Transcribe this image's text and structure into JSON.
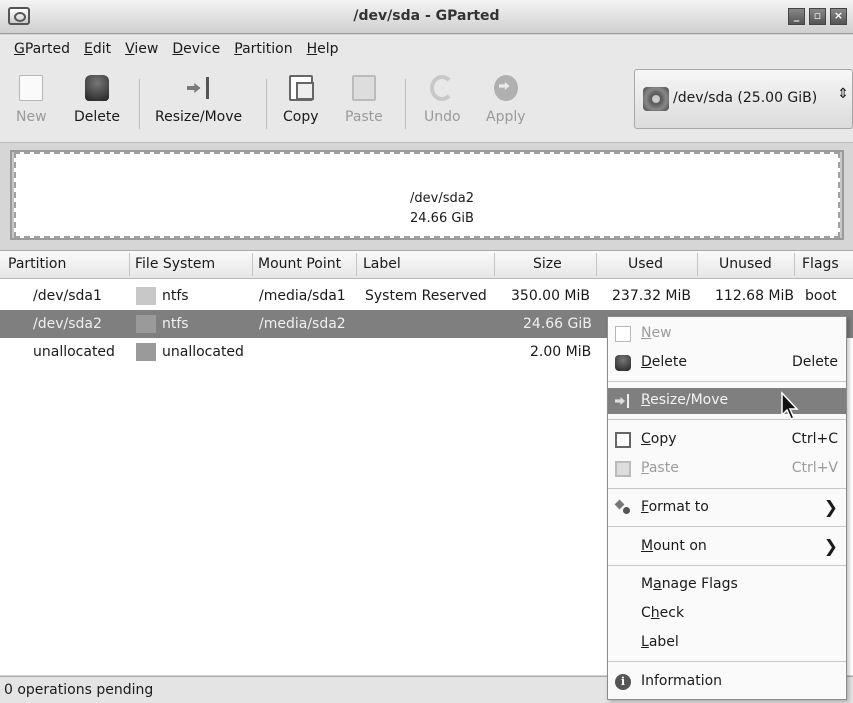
{
  "window": {
    "title": "/dev/sda - GParted",
    "controls": [
      "_",
      "▫",
      "×"
    ]
  },
  "menubar": {
    "items": [
      {
        "label": "GParted",
        "mnemonic": "G"
      },
      {
        "label": "Edit",
        "mnemonic": "E"
      },
      {
        "label": "View",
        "mnemonic": "V"
      },
      {
        "label": "Device",
        "mnemonic": "D"
      },
      {
        "label": "Partition",
        "mnemonic": "P"
      },
      {
        "label": "Help",
        "mnemonic": "H"
      }
    ]
  },
  "toolbar": {
    "new_label": "New",
    "delete_label": "Delete",
    "resize_label": "Resize/Move",
    "copy_label": "Copy",
    "paste_label": "Paste",
    "undo_label": "Undo",
    "apply_label": "Apply",
    "device": "/dev/sda  (25.00 GiB)",
    "device_spinner": "⇕"
  },
  "graphic": {
    "partition_name": "/dev/sda2",
    "partition_size": "24.66 GiB"
  },
  "table": {
    "headers": [
      "Partition",
      "File System",
      "Mount Point",
      "Label",
      "Size",
      "Used",
      "Unused",
      "Flags"
    ],
    "rows": [
      {
        "partition": "/dev/sda1",
        "fs": "ntfs",
        "fs_color": "#c8c8c8",
        "mount": "/media/sda1",
        "label": "System Reserved",
        "size": "350.00 MiB",
        "used": "237.32 MiB",
        "unused": "112.68 MiB",
        "flags": "boot",
        "selected": false
      },
      {
        "partition": "/dev/sda2",
        "fs": "ntfs",
        "fs_color": "#9a9a9a",
        "mount": "/media/sda2",
        "label": "",
        "size": "24.66 GiB",
        "used": "",
        "unused": "",
        "flags": "",
        "selected": true
      },
      {
        "partition": "unallocated",
        "fs": "unallocated",
        "fs_color": "#9a9a9a",
        "mount": "",
        "label": "",
        "size": "2.00 MiB",
        "used": "",
        "unused": "",
        "flags": "",
        "selected": false
      }
    ]
  },
  "statusbar": {
    "text": "0 operations pending"
  },
  "context_menu": {
    "new": {
      "pre": "",
      "u": "N",
      "post": "ew"
    },
    "delete": {
      "pre": "",
      "u": "D",
      "post": "elete",
      "accel": "Delete"
    },
    "resize": {
      "pre": "",
      "u": "R",
      "post": "esize/Move"
    },
    "copy": {
      "pre": "",
      "u": "C",
      "post": "opy",
      "accel": "Ctrl+C"
    },
    "paste": {
      "pre": "",
      "u": "P",
      "post": "aste",
      "accel": "Ctrl+V"
    },
    "format": {
      "pre": "",
      "u": "F",
      "post": "ormat to"
    },
    "mount": {
      "pre": "",
      "u": "M",
      "post": "ount on"
    },
    "flags": {
      "pre": "M",
      "u": "a",
      "post": "nage Flags"
    },
    "check": {
      "pre": "C",
      "u": "h",
      "post": "eck"
    },
    "label": {
      "pre": "",
      "u": "L",
      "post": "abel"
    },
    "info": {
      "label": "Information"
    },
    "submenu_arrow": "❯"
  },
  "colors": {
    "selection": "#7f7f7f",
    "window_bg": "#d6d6d6"
  }
}
